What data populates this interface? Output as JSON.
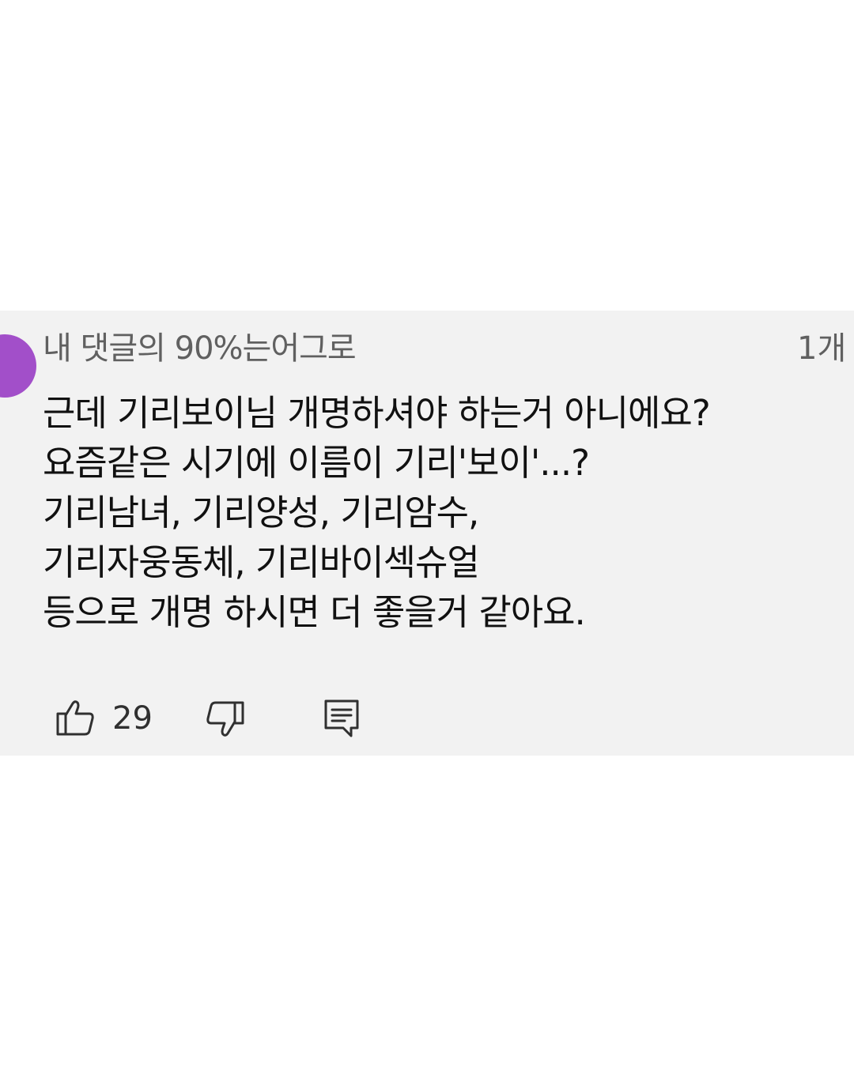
{
  "comment": {
    "author": "내 댓글의 90%는어그로",
    "time": "1개",
    "lines": [
      "근데 기리보이님 개명하셔야 하는거 아니에요?",
      "요즘같은 시기에 이름이 기리'보이'...?",
      "기리남녀, 기리양성, 기리암수,",
      "기리자웅동체, 기리바이섹슈얼",
      "등으로 개명 하시면 더 좋을거 같아요."
    ],
    "like_count": "29",
    "avatar_color": "#a24fc9"
  },
  "icons": {
    "like": "thumbs-up-icon",
    "dislike": "thumbs-down-icon",
    "reply": "reply-comment-icon"
  }
}
